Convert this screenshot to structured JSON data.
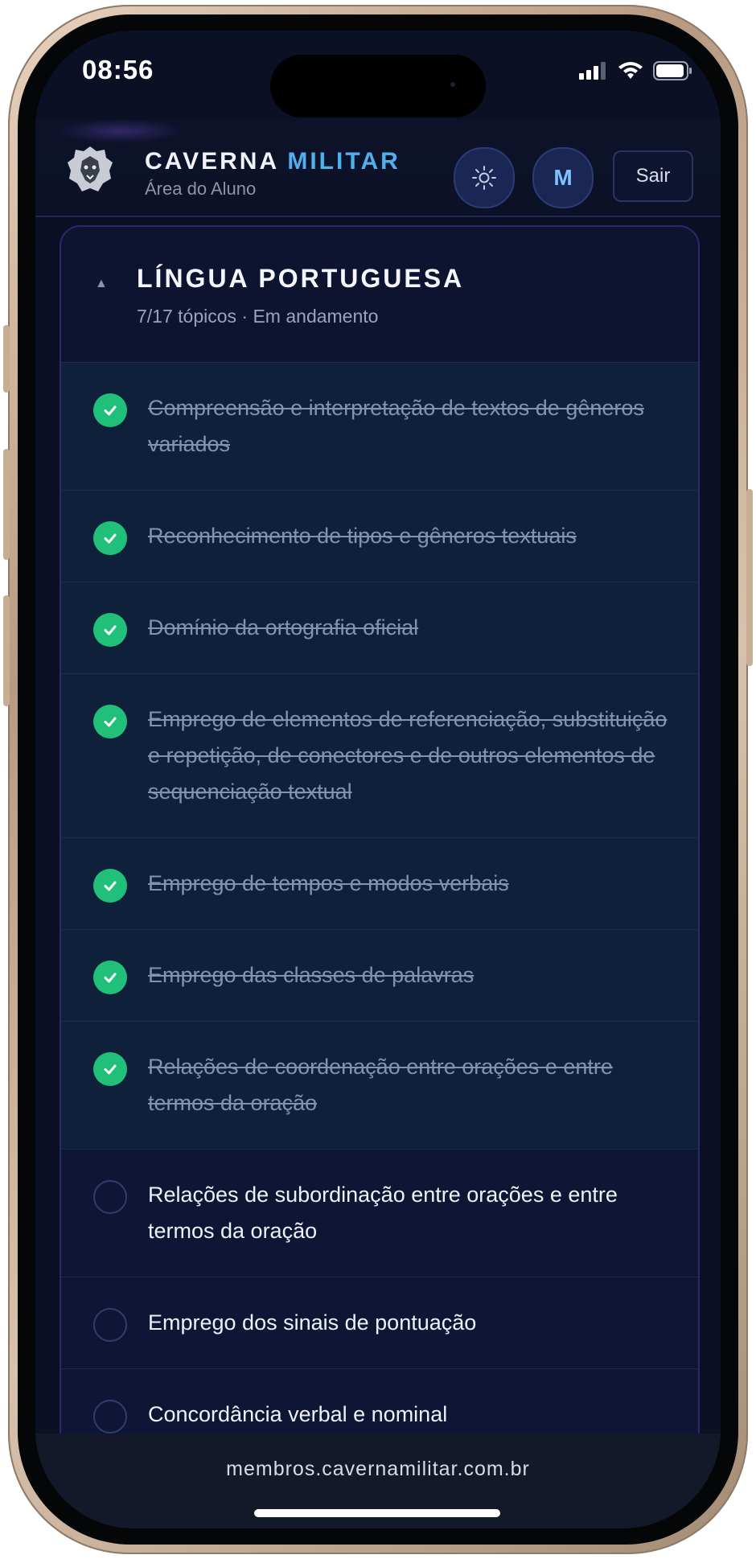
{
  "status_bar": {
    "time": "08:56"
  },
  "header": {
    "brand_part1": "CAVERNA",
    "brand_part2": "MILITAR",
    "subtitle": "Área do Aluno",
    "avatar_initial": "M",
    "logout_label": "Sair"
  },
  "subject": {
    "title": "LÍNGUA PORTUGUESA",
    "progress": "7/17 tópicos · Em andamento",
    "topics": [
      {
        "label": "Compreensão e interpretação de textos de gêneros variados",
        "done": true
      },
      {
        "label": "Reconhecimento de tipos e gêneros textuais",
        "done": true
      },
      {
        "label": "Domínio da ortografia oficial",
        "done": true
      },
      {
        "label": "Emprego de elementos de referenciação, substituição e repetição, de conectores e de outros elementos de sequenciação textual",
        "done": true
      },
      {
        "label": "Emprego de tempos e modos verbais",
        "done": true
      },
      {
        "label": "Emprego das classes de palavras",
        "done": true
      },
      {
        "label": "Relações de coordenação entre orações e entre termos da oração",
        "done": true
      },
      {
        "label": "Relações de subordinação entre orações e entre termos da oração",
        "done": false
      },
      {
        "label": "Emprego dos sinais de pontuação",
        "done": false
      },
      {
        "label": "Concordância verbal e nominal",
        "done": false
      }
    ]
  },
  "browser": {
    "url": "membros.cavernamilitar.com.br"
  },
  "colors": {
    "accent": "#4fb0ee",
    "done": "#20c07a",
    "background": "#0b1024"
  }
}
